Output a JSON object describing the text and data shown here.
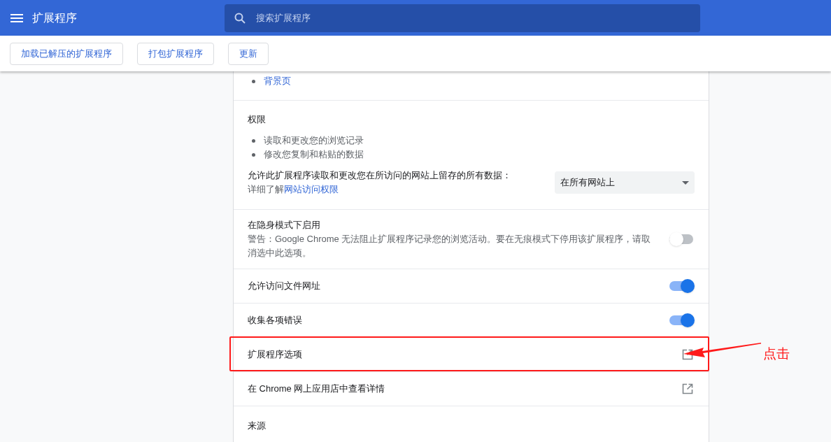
{
  "header": {
    "title": "扩展程序",
    "search": {
      "placeholder": "搜索扩展程序"
    }
  },
  "toolbar": {
    "buttons": [
      "加载已解压的扩展程序",
      "打包扩展程序",
      "更新"
    ]
  },
  "sections": [
    {
      "kind": "links",
      "items": [
        "背景页"
      ]
    },
    {
      "kind": "permissions",
      "title": "权限",
      "items": [
        "读取和更改您的浏览记录",
        "修改您复制和粘贴的数据"
      ],
      "site_access": {
        "label": "允许此扩展程序读取和更改您在所访问的网站上留存的所有数据：",
        "learn_prefix": "详细了解",
        "learn_link": "网站访问权限",
        "dropdown": "在所有网站上"
      }
    },
    {
      "kind": "toggle",
      "title": "在隐身模式下启用",
      "description": "警告：Google Chrome 无法阻止扩展程序记录您的浏览活动。要在无痕模式下停用该扩展程序，请取消选中此选项。",
      "on": false
    },
    {
      "kind": "toggle",
      "title": "允许访问文件网址",
      "on": true
    },
    {
      "kind": "toggle",
      "title": "收集各项错误",
      "on": true
    },
    {
      "kind": "external",
      "title": "扩展程序选项",
      "highlighted": true
    },
    {
      "kind": "external",
      "title": "在 Chrome 网上应用店中查看详情",
      "highlighted": false
    },
    {
      "kind": "heading",
      "title": "来源"
    }
  ],
  "annotation": {
    "text": "点击"
  }
}
